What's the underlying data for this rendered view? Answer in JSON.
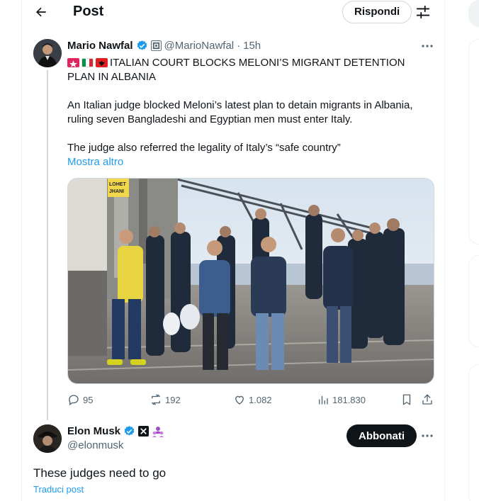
{
  "header": {
    "title": "Post",
    "reply_label": "Rispondi",
    "back_icon": "arrow-left-icon",
    "filter_icon": "sliders-icon"
  },
  "tweet": {
    "author_name": "Mario Nawfal",
    "handle": "@MarioNawfal",
    "separator": "·",
    "time": "15h",
    "headline": "ITALIAN COURT BLOCKS MELONI’S MIGRANT DETENTION PLAN IN ALBANIA",
    "paragraph_1": "An Italian judge blocked Meloni’s latest plan to detain migrants in Albania, ruling seven Bangladeshi and Egyptian men must enter Italy.",
    "paragraph_2": "The judge also referred the legality of Italy’s “safe country”",
    "show_more": "Mostra altro",
    "image_sign_text": "LOHET\nJHANI",
    "stats": {
      "replies": "95",
      "reposts": "192",
      "likes": "1.082",
      "views": "181.830"
    }
  },
  "reply": {
    "author_name": "Elon Musk",
    "handle": "@elonmusk",
    "subscribe_label": "Abbonati",
    "text": "These judges need to go",
    "translate": "Traduci post"
  },
  "colors": {
    "link": "#1d9bf0",
    "muted": "#536471",
    "verified": "#1d9bf0",
    "text": "#0f1419"
  }
}
